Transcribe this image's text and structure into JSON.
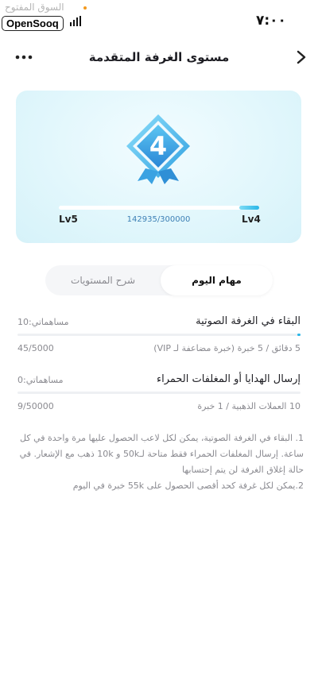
{
  "status_bar": {
    "time": "٧:٠٠",
    "logo_text": "OpenSooq",
    "watermark": "السوق المفتوح",
    "signal_bars": 4
  },
  "header": {
    "title": "مستوى الغرفة المتقدمة",
    "back_icon": "chevron-right-icon",
    "more_icon": "more-horizontal-icon"
  },
  "level_card": {
    "current_level": "4",
    "badge_icon": "level-badge-icon",
    "current_level_label": "Lv4",
    "next_level_label": "Lv5",
    "progress_text": "142935/300000",
    "progress_fraction": 0.1,
    "colors": {
      "accent": "#29b6e8",
      "card_bg": "#e2f7fc",
      "badge": "#4ab3e8"
    }
  },
  "tabs": {
    "active_label": "مهام اليوم",
    "inactive_label": "شرح المستويات"
  },
  "tasks": [
    {
      "title": "البقاء في الغرفة الصوتية",
      "contribution": "مساهماتي:10",
      "description": "5 دقائق / 5 خبرة (خبرة مضاعفة لـ VIP)",
      "progress": "45/5000",
      "progress_fraction": 0.009
    },
    {
      "title": "إرسال الهدايا أو المغلفات الحمراء",
      "contribution": "مساهماتي:0",
      "description": "10 العملات الذهبية / 1 خبرة",
      "progress": "9/50000",
      "progress_fraction": 0
    }
  ],
  "notes": {
    "line1": "1. البقاء في الغرفة الصوتية، يمكن لكل لاعب الحصول عليها مرة واحدة في كل ساعة. إرسال المغلفات الحمراء فقط متاحة لـ50k و 10k ذهب مع الإشعار. في حالة إغلاق الغرفة لن يتم إحتسابها",
    "line2": "2.يمكن لكل غرفة كحد أقصى الحصول على 55k خبرة في اليوم"
  }
}
